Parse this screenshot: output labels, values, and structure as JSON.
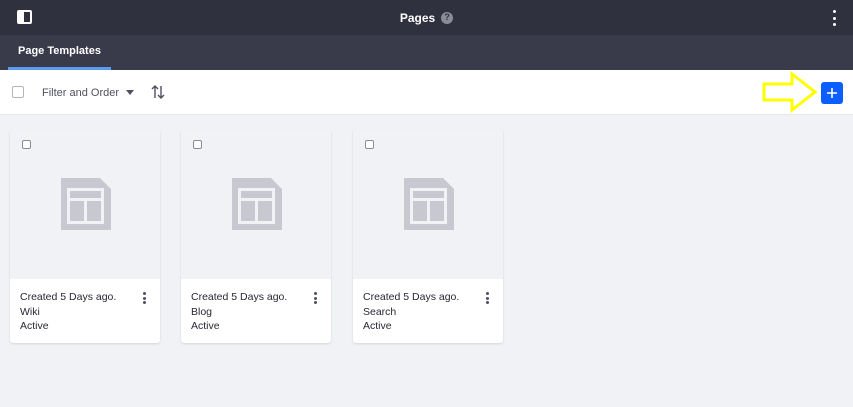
{
  "header": {
    "title": "Pages",
    "help_symbol": "?",
    "left_icon": "product-menu-toggle-icon",
    "right_icon": "ellipsis-vertical-icon"
  },
  "tabs": [
    {
      "label": "Page Templates",
      "active": true
    }
  ],
  "management_bar": {
    "filter_label": "Filter and Order",
    "sort_icon": "order-arrows-icon",
    "add_icon": "plus-icon"
  },
  "cards": [
    {
      "created": "Created 5 Days ago.",
      "name": "Wiki",
      "status": "Active"
    },
    {
      "created": "Created 5 Days ago.",
      "name": "Blog",
      "status": "Active"
    },
    {
      "created": "Created 5 Days ago.",
      "name": "Search",
      "status": "Active"
    }
  ],
  "colors": {
    "header_bg": "#30313f",
    "tabbar_bg": "#393a4a",
    "accent": "#0b5fff",
    "annotation_arrow": "#ffff00"
  }
}
